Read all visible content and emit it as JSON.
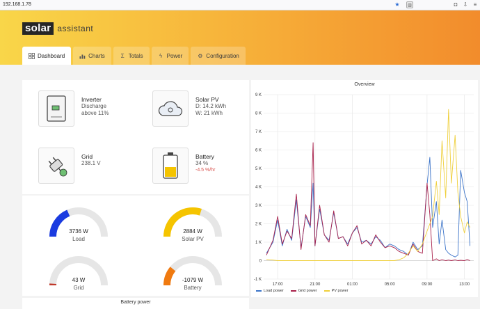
{
  "browser": {
    "url": "192.168.1.78"
  },
  "app": {
    "logo_box": "solar",
    "logo_text": "assistant"
  },
  "tabs": [
    {
      "label": "Dashboard",
      "icon": "dashboard-icon",
      "active": true
    },
    {
      "label": "Charts",
      "icon": "bar-chart-icon"
    },
    {
      "label": "Totals",
      "icon": "sigma-icon"
    },
    {
      "label": "Power",
      "icon": "lightning-icon"
    },
    {
      "label": "Configuration",
      "icon": "gear-icon"
    }
  ],
  "cards": {
    "inverter": {
      "title": "Inverter",
      "line1": "Discharge",
      "line2": "above 11%"
    },
    "solar": {
      "title": "Solar PV",
      "line1": "D: 14.2 kWh",
      "line2": "W: 21 kWh"
    },
    "grid": {
      "title": "Grid",
      "line1": "238.1 V"
    },
    "battery": {
      "title": "Battery",
      "line1": "34 %",
      "line2": "-4.5 %/hr"
    }
  },
  "gauges": {
    "load": {
      "value": "3736 W",
      "label": "Load",
      "fraction": 0.37,
      "color": "#1a3be0"
    },
    "solar": {
      "value": "2884 W",
      "label": "Solar PV",
      "fraction": 0.6,
      "color": "#f5c400"
    },
    "grid": {
      "value": "43 W",
      "label": "Grid",
      "fraction": 0.02,
      "color": "#c0392b"
    },
    "battery": {
      "value": "-1079 W",
      "label": "Battery",
      "fraction": 0.22,
      "color": "#f07a10"
    }
  },
  "battery_power": {
    "title": "Battery power"
  },
  "chart_data": {
    "type": "line",
    "title": "Overview",
    "y_ticks": [
      "9 K",
      "8 K",
      "7 K",
      "6 K",
      "5 K",
      "4 K",
      "3 K",
      "2 K",
      "1 K",
      "0",
      "-1 K"
    ],
    "x_ticks": [
      "17:00",
      "21:00",
      "01:00",
      "05:00",
      "09:00",
      "13:00"
    ],
    "ylim": [
      -1000,
      9000
    ],
    "x_hours": [
      15.8,
      16.5,
      17.0,
      17.5,
      18.0,
      18.5,
      19.0,
      19.5,
      20.0,
      20.5,
      20.8,
      21.0,
      21.5,
      22.0,
      22.5,
      23.0,
      23.5,
      24.0,
      24.5,
      25.0,
      25.5,
      26.0,
      26.5,
      27.0,
      27.5,
      28.0,
      28.5,
      29.0,
      29.5,
      30.0,
      30.5,
      31.0,
      31.5,
      32.0,
      32.5,
      33.0,
      33.3,
      33.6,
      34.0,
      34.3,
      34.6,
      35.0,
      35.3,
      35.6,
      36.0,
      36.3,
      36.6,
      37.0,
      37.3,
      37.6
    ],
    "series": [
      {
        "name": "Load power",
        "color": "#3b73c8",
        "values": [
          400,
          1000,
          2200,
          800,
          1700,
          1100,
          3300,
          700,
          2400,
          1800,
          4200,
          800,
          2800,
          1400,
          1100,
          2600,
          1200,
          1300,
          900,
          1500,
          1800,
          1000,
          1100,
          900,
          1300,
          1100,
          700,
          900,
          800,
          600,
          500,
          300,
          1000,
          600,
          800,
          4100,
          5600,
          1800,
          3200,
          900,
          2200,
          600,
          400,
          300,
          200,
          300,
          4900,
          3700,
          3200,
          800
        ]
      },
      {
        "name": "Grid power",
        "color": "#a8204a",
        "values": [
          300,
          1100,
          2400,
          900,
          1600,
          1200,
          3600,
          600,
          2500,
          1900,
          6400,
          800,
          3000,
          1400,
          1000,
          2700,
          1200,
          1300,
          800,
          1500,
          1900,
          900,
          1100,
          800,
          1400,
          1000,
          700,
          800,
          700,
          500,
          400,
          300,
          900,
          500,
          400,
          4200,
          2500,
          0,
          100,
          0,
          50,
          0,
          30,
          0,
          40,
          0,
          20,
          0,
          60,
          0
        ]
      },
      {
        "name": "PV power",
        "color": "#efcf3a",
        "values": [
          60,
          30,
          0,
          0,
          0,
          0,
          0,
          0,
          0,
          0,
          0,
          0,
          0,
          0,
          0,
          0,
          0,
          0,
          0,
          0,
          0,
          0,
          0,
          0,
          0,
          0,
          0,
          0,
          0,
          50,
          150,
          400,
          800,
          500,
          900,
          1600,
          2000,
          2400,
          4300,
          2500,
          6500,
          3400,
          8200,
          4200,
          6800,
          3700,
          2400,
          1500,
          2100,
          1800
        ]
      }
    ]
  },
  "colors": {
    "header_start": "#f9d649",
    "header_end": "#f28c2c",
    "gauge_track": "#e6e6e6"
  }
}
